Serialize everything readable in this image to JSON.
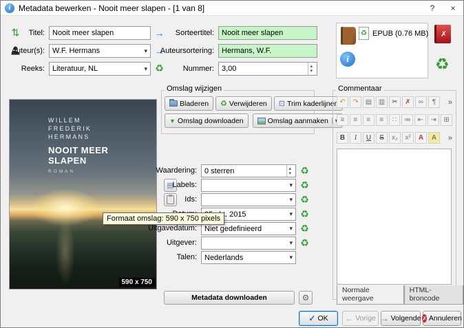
{
  "window": {
    "title": "Metadata bewerken - Nooit meer slapen -  [1 van 8]",
    "help": "?",
    "close": "×"
  },
  "basic": {
    "title_label": "Titel:",
    "title_value": "Nooit meer slapen",
    "sort_title_label": "Sorteertitel:",
    "sort_title_value": "Nooit meer slapen",
    "authors_label": "Auteur(s):",
    "authors_value": "W.F. Hermans",
    "author_sort_label": "Auteursortering:",
    "author_sort_value": "Hermans, W.F.",
    "series_label": "Reeks:",
    "series_value": "Literatuur, NL",
    "number_label": "Nummer:",
    "number_value": "3,00"
  },
  "formats": {
    "epub_label": "EPUB (0.76 MB)"
  },
  "cover_group": {
    "label": "Omslag wijzigen",
    "browse": "Bladeren",
    "remove": "Verwijderen",
    "trim": "Trim kaderlijnen",
    "download": "Omslag downloaden",
    "generate": "Omslag aanmaken"
  },
  "cover": {
    "author_lines": [
      "WILLEM",
      "FREDERIK",
      "HERMANS"
    ],
    "title_lines": [
      "NOOIT MEER",
      "SLAPEN"
    ],
    "tagline": "ROMAN",
    "size_badge": "590 x 750",
    "tooltip": "Formaat omslag: 590 x 750 pixels"
  },
  "details": {
    "rating_label": "Waardering:",
    "rating_value": "0 sterren",
    "tags_label": "Labels:",
    "tags_value": "",
    "ids_label": "Ids:",
    "ids_value": "",
    "date_label": "Datum:",
    "date_value": "25 okt. 2015",
    "pubdate_label": "Uitgavedatum:",
    "pubdate_value": "Niet gedefinieerd",
    "publisher_label": "Uitgever:",
    "publisher_value": "",
    "languages_label": "Talen:",
    "languages_value": "Nederlands",
    "download_button": "Metadata downloaden"
  },
  "comments": {
    "label": "Commentaar",
    "tab_normal": "Normale weergave",
    "tab_html": "HTML-broncode",
    "content": ""
  },
  "footer": {
    "ok": "OK",
    "previous": "Vorige",
    "next": "Volgende",
    "cancel": "Annuleren"
  },
  "colors": {
    "highlight_green": "#c6f5c6",
    "accent_blue": "#0078d7",
    "action_green": "#2f9e2f"
  },
  "icons": {
    "info": "i",
    "swap": "⇅",
    "copy_arrow": "→",
    "recycle": "♻",
    "dropdown": "▾",
    "spin_up": "▴",
    "spin_down": "▾",
    "trim": "⊡",
    "download_arrow": "▼",
    "tags_editor": "▤",
    "gear": "⚙",
    "undo": "↶",
    "redo": "↷",
    "copy": "▤",
    "paste": "▥",
    "cut": "✂",
    "clear": "✗",
    "link": "∞",
    "pilcrow": "¶",
    "align": "≡",
    "bullets": "∷",
    "numbers": "≔",
    "outdent": "⇤",
    "indent": "⇥",
    "table": "⊞",
    "bold": "B",
    "italic": "I",
    "underline": "U",
    "strike": "S",
    "subscript": "x₂",
    "superscript": "x²",
    "fgcolor": "A",
    "bgcolor": "A",
    "more": "»",
    "check": "✓",
    "prev_arrow": "←",
    "next_arrow": "→",
    "cancel_x": "✗"
  }
}
